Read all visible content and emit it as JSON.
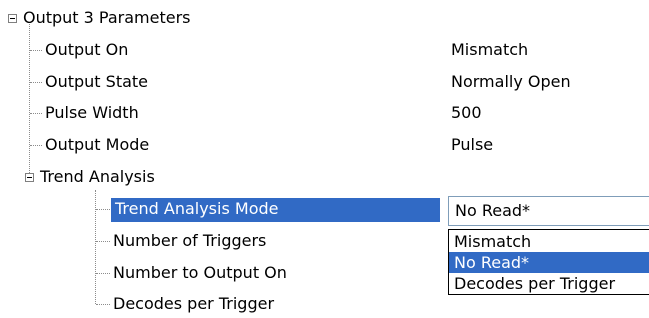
{
  "tree": {
    "root": {
      "label": "Output 3 Parameters",
      "children": [
        {
          "label": "Output On",
          "value": "Mismatch"
        },
        {
          "label": "Output State",
          "value": "Normally Open"
        },
        {
          "label": "Pulse Width",
          "value": "500"
        },
        {
          "label": "Output Mode",
          "value": "Pulse"
        }
      ]
    },
    "trend": {
      "label": "Trend Analysis",
      "children": [
        {
          "label": "Trend Analysis Mode"
        },
        {
          "label": "Number of Triggers"
        },
        {
          "label": "Number to Output On"
        },
        {
          "label": "Decodes per Trigger"
        }
      ]
    }
  },
  "combo": {
    "value": "No Read*"
  },
  "dropdown": {
    "options": [
      "Mismatch",
      "No Read*",
      "Decodes per Trigger"
    ],
    "selected": "No Read*"
  },
  "colors": {
    "selection": "#316ac5",
    "connector": "#8c8c8c",
    "expander_border": "#7f7f7f"
  }
}
